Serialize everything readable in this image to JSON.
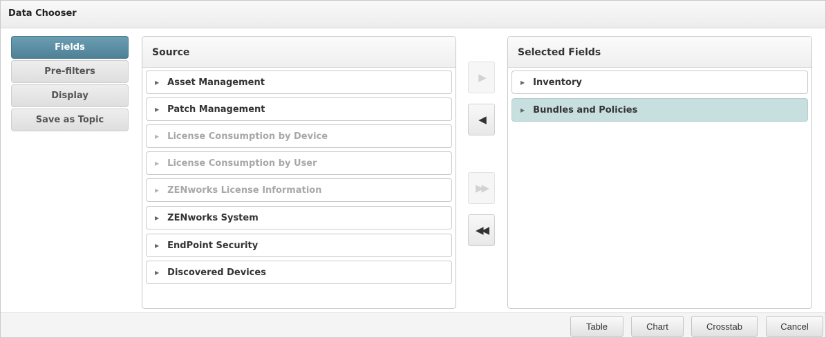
{
  "window": {
    "title": "Data Chooser"
  },
  "nav": {
    "items": [
      {
        "label": "Fields",
        "active": true
      },
      {
        "label": "Pre-filters",
        "active": false
      },
      {
        "label": "Display",
        "active": false
      },
      {
        "label": "Save as Topic",
        "active": false
      }
    ]
  },
  "source": {
    "header": "Source",
    "items": [
      {
        "label": "Asset Management",
        "enabled": true
      },
      {
        "label": "Patch Management",
        "enabled": true
      },
      {
        "label": "License Consumption by Device",
        "enabled": false
      },
      {
        "label": "License Consumption by User",
        "enabled": false
      },
      {
        "label": "ZENworks License Information",
        "enabled": false
      },
      {
        "label": "ZENworks System",
        "enabled": true
      },
      {
        "label": "EndPoint Security",
        "enabled": true
      },
      {
        "label": "Discovered Devices",
        "enabled": true
      }
    ]
  },
  "selected": {
    "header": "Selected Fields",
    "items": [
      {
        "label": "Inventory",
        "selected": false
      },
      {
        "label": "Bundles and Policies",
        "selected": true
      }
    ]
  },
  "arrows": {
    "add": {
      "icon": "arrow-right-icon",
      "enabled": false
    },
    "remove": {
      "icon": "arrow-left-icon",
      "enabled": true
    },
    "add_all": {
      "icon": "double-arrow-right-icon",
      "enabled": false
    },
    "remove_all": {
      "icon": "double-arrow-left-icon",
      "enabled": true
    }
  },
  "footer": {
    "table_label": "Table",
    "chart_label": "Chart",
    "crosstab_label": "Crosstab",
    "cancel_label": "Cancel"
  },
  "colors": {
    "active_nav": "#5a8da2",
    "selected_row": "#c8dfe0"
  }
}
